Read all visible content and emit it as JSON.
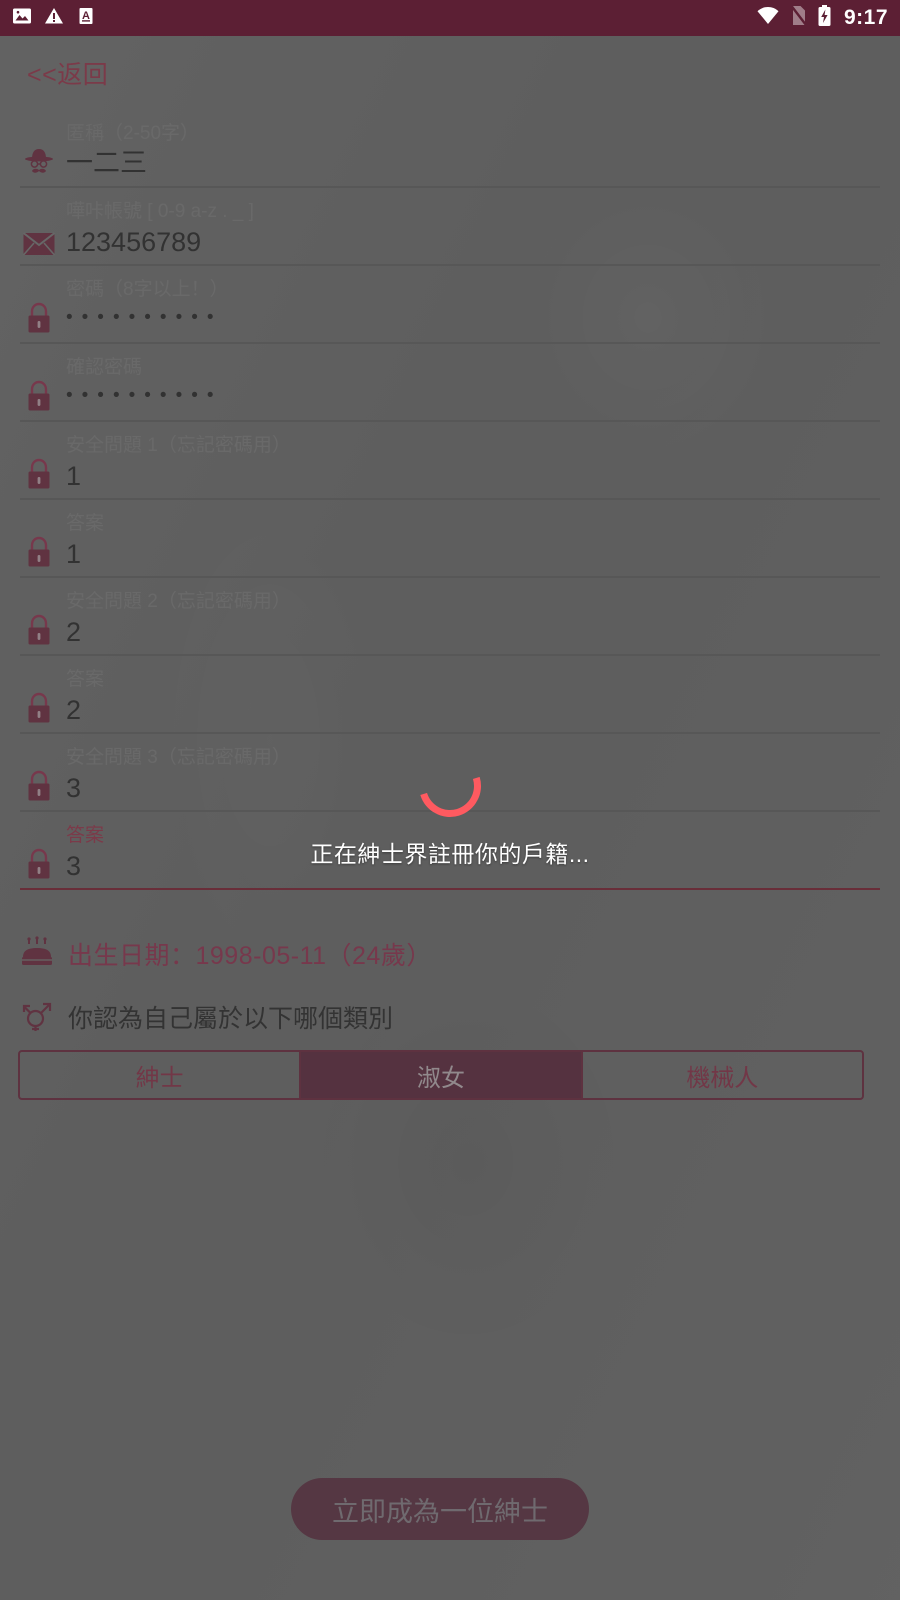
{
  "statusbar": {
    "time": "9:17",
    "left_icons": [
      "image-icon",
      "warning-icon",
      "letter-a-icon"
    ],
    "right_icons": [
      "wifi-icon",
      "no-sim-icon",
      "battery-charging-icon"
    ]
  },
  "back_link": {
    "label": "<<返回"
  },
  "form": {
    "fields": [
      {
        "label": "匿稱（2-50字）",
        "value": "一二三",
        "icon": "gentleman-hat-icon",
        "type": "text",
        "focused": false
      },
      {
        "label": "嘩咔帳號 [ 0-9 a-z . _ ]",
        "value": "123456789",
        "icon": "envelope-icon",
        "type": "text",
        "focused": false
      },
      {
        "label": "密碼（8字以上！）",
        "value": "••••••••••",
        "icon": "lock-icon",
        "type": "password",
        "focused": false
      },
      {
        "label": "確認密碼",
        "value": "••••••••••",
        "icon": "lock-icon",
        "type": "password",
        "focused": false
      },
      {
        "label": "安全問題 1（忘記密碼用）",
        "value": "1",
        "icon": "lock-icon",
        "type": "text",
        "focused": false
      },
      {
        "label": "答案",
        "value": "1",
        "icon": "lock-icon",
        "type": "text",
        "focused": false
      },
      {
        "label": "安全問題 2（忘記密碼用）",
        "value": "2",
        "icon": "lock-icon",
        "type": "text",
        "focused": false
      },
      {
        "label": "答案",
        "value": "2",
        "icon": "lock-icon",
        "type": "text",
        "focused": false
      },
      {
        "label": "安全問題 3（忘記密碼用）",
        "value": "3",
        "icon": "lock-icon",
        "type": "text",
        "focused": false
      },
      {
        "label": "答案",
        "value": "3",
        "icon": "lock-icon",
        "type": "text",
        "focused": true
      }
    ]
  },
  "birthday": {
    "icon": "birthday-cake-icon",
    "text": "出生日期：1998-05-11（24歲）"
  },
  "gender": {
    "icon": "transgender-icon",
    "question": "你認為自己屬於以下哪個類別",
    "options": [
      {
        "label": "紳士",
        "selected": false
      },
      {
        "label": "淑女",
        "selected": true
      },
      {
        "label": "機械人",
        "selected": false
      }
    ]
  },
  "submit": {
    "label": "立即成為一位紳士"
  },
  "loading": {
    "text": "正在紳士界註冊你的戶籍...",
    "spinner": "circular-spinner"
  },
  "colors": {
    "statusbar_bg": "#5c1f34",
    "accent": "#a8365a",
    "segment_selected_bg": "#6b2b44",
    "submit_bg": "#6b3449",
    "spinner": "#ff5a60",
    "focused_underline": "#8e2338",
    "icon_maroon": "#7e2d46"
  }
}
